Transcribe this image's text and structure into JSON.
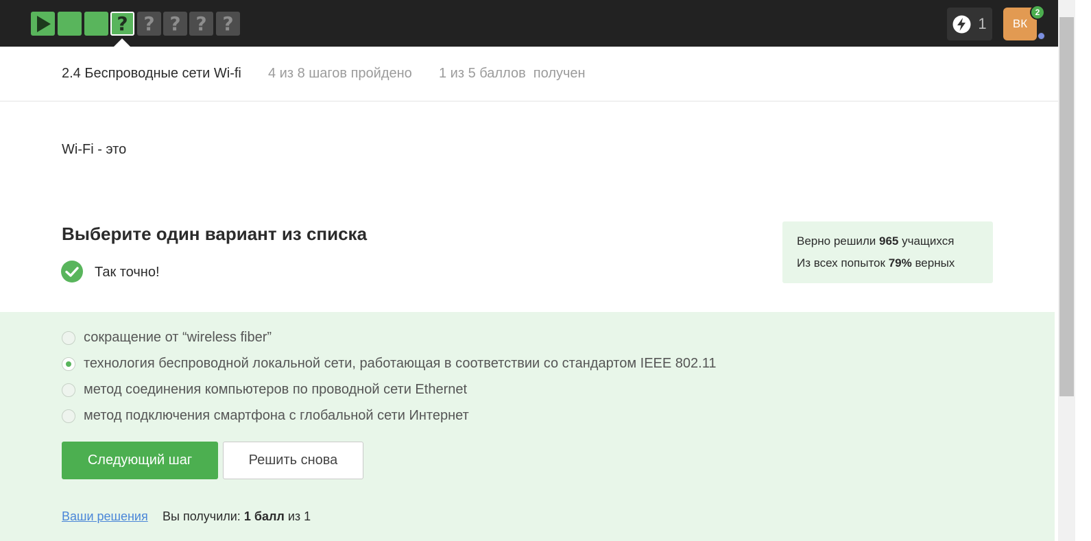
{
  "progress": {
    "steps": [
      {
        "type": "play",
        "state": "done"
      },
      {
        "type": "text",
        "state": "done"
      },
      {
        "type": "text",
        "state": "done"
      },
      {
        "type": "question",
        "state": "done-current"
      },
      {
        "type": "question",
        "state": "todo"
      },
      {
        "type": "question",
        "state": "todo"
      },
      {
        "type": "question",
        "state": "todo"
      },
      {
        "type": "question",
        "state": "todo"
      }
    ],
    "step_symbol": "?"
  },
  "header": {
    "energy_icon": "lightning-icon",
    "energy_count": "1",
    "avatar_initials": "ВК",
    "notification_count": "2"
  },
  "lesson": {
    "title": "2.4 Беспроводные сети Wi-fi",
    "steps_done": "4 из 8 шагов пройдено",
    "score": "1 из 5 баллов  получен"
  },
  "question": {
    "text": "Wi-Fi - это"
  },
  "quiz": {
    "heading": "Выберите один вариант из списка",
    "feedback": "Так точно!",
    "options": [
      {
        "label": "сокращение от “wireless fiber”",
        "selected": false
      },
      {
        "label": "технология беспроводной локальной сети, работающая в соответствии со стандартом IEEE 802.11",
        "selected": true
      },
      {
        "label": "метод соединения компьютеров по проводной сети Ethernet",
        "selected": false
      },
      {
        "label": "метод подключения смартфона с глобальной сети Интернет",
        "selected": false
      }
    ],
    "next_button": "Следующий шаг",
    "retry_button": "Решить снова"
  },
  "stats": {
    "solved_prefix": "Верно решили ",
    "solved_count": "965",
    "solved_suffix": " учащихся",
    "attempts_prefix": "Из всех попыток ",
    "attempts_percent": "79%",
    "attempts_suffix": " верных"
  },
  "footer": {
    "solutions_link": "Ваши решения",
    "result_prefix": "Вы получили: ",
    "result_value": "1 балл",
    "result_suffix": " из 1"
  },
  "colors": {
    "accent_green": "#59b55c",
    "topbar": "#222222",
    "answers_bg": "#e8f6e9",
    "link": "#4a86d8",
    "avatar": "#e29a52"
  }
}
